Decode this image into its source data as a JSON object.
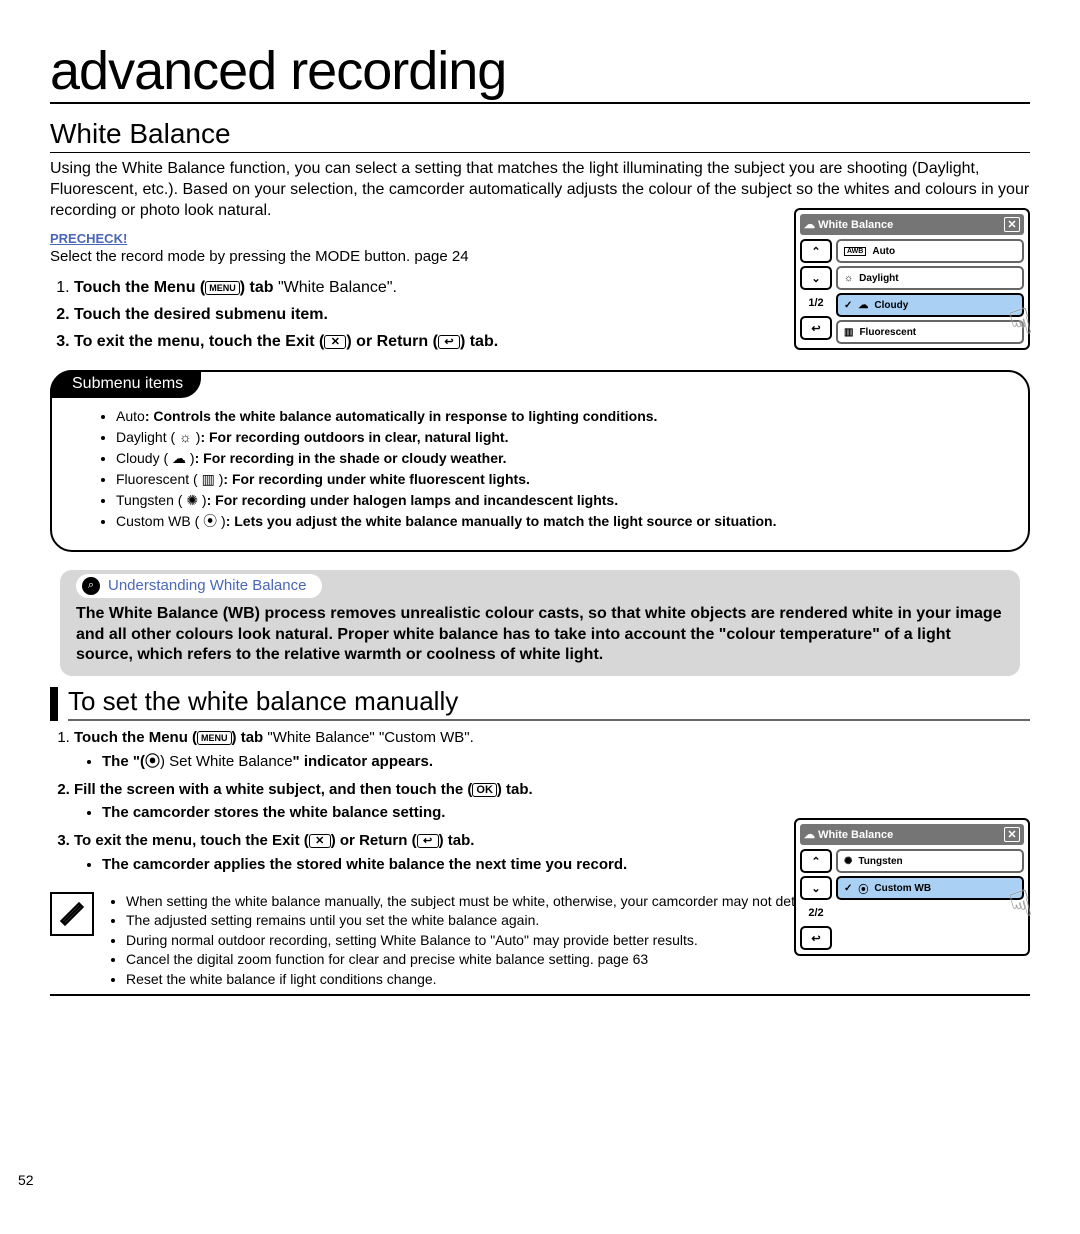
{
  "page_number": "52",
  "title": "advanced recording",
  "section_title": "White Balance",
  "intro": "Using the White Balance function, you can select a setting that matches the light illuminating the subject you are shooting (Daylight, Fluorescent, etc.). Based on your selection, the camcorder automatically adjusts the colour of the subject so the whites and colours in your recording or photo look natural.",
  "precheck_label": "PRECHECK!",
  "select_record": "Select the record mode by pressing the MODE button. page 24",
  "menu_chip": "MENU",
  "steps": {
    "s1a": "Touch the Menu (",
    "s1b": ") tab ",
    "s1c": " \"White Balance\".",
    "s2": "Touch the desired submenu item.",
    "s3a": "To exit the menu, touch the Exit (",
    "s3b": ") or Return (",
    "s3c": ") tab."
  },
  "exit_icon": "✕",
  "return_icon": "↩",
  "ok_icon": "OK",
  "submenu_label": "Submenu items",
  "submenu_items": [
    {
      "name": "Auto",
      "icon": "",
      "desc": ": Controls the white balance automatically in response to lighting conditions."
    },
    {
      "name": "Daylight",
      "icon": "☼",
      "desc": ": For recording outdoors in clear, natural light."
    },
    {
      "name": "Cloudy",
      "icon": "☁",
      "desc": ": For recording in the shade or cloudy weather."
    },
    {
      "name": "Fluorescent",
      "icon": "▥",
      "desc": ": For recording under white fluorescent lights."
    },
    {
      "name": "Tungsten",
      "icon": "✺",
      "desc": ": For recording under halogen lamps and incandescent lights."
    },
    {
      "name": "Custom WB",
      "icon": "⦿",
      "desc": ": Lets you adjust the white balance manually to match the light source or situation."
    }
  ],
  "understanding_title": "Understanding White Balance",
  "understanding_body": "The White Balance (WB) process removes unrealistic colour casts, so that white objects are rendered white in your image and all other colours look natural. Proper white balance has to take into account the \"colour temperature\" of a light source, which refers to the relative warmth or coolness of white light.",
  "manual_title": "To set the white balance manually",
  "manual": {
    "m1a": "Touch the Menu (",
    "m1b": ") tab ",
    "m1c": " \"White Balance\" ",
    "m1d": " \"Custom WB\".",
    "m1_sub_a": "The \"(",
    "m1_sub_b": ") Set White Balance\" indicator appears.",
    "m2": "Fill the screen with a white subject, and then touch the (",
    "m2b": ") tab.",
    "m2_sub": "The camcorder stores the white balance setting.",
    "m3a": "To exit the menu, touch the Exit (",
    "m3b": ") or Return (",
    "m3c": ") tab.",
    "m3_sub": "The camcorder applies the stored white balance the next time you record."
  },
  "notes": [
    "When setting the white balance manually, the subject must be white, otherwise, your camcorder may not detect an appropriate setting value.",
    "The adjusted setting remains until you set the white balance again.",
    "During normal outdoor recording, setting White Balance to \"Auto\" may provide better results.",
    "Cancel the digital zoom function for clear and precise white balance setting. page 63",
    "Reset the white balance if light conditions change."
  ],
  "device1": {
    "title": "White Balance",
    "counter": "1/2",
    "rows": [
      "Auto",
      "Daylight",
      "Cloudy",
      "Fluorescent"
    ],
    "icons": [
      "AWB",
      "☼",
      "☁",
      "▥"
    ],
    "selected": 2
  },
  "device2": {
    "title": "White Balance",
    "counter": "2/2",
    "rows": [
      "Tungsten",
      "Custom WB"
    ],
    "icons": [
      "✺",
      "⦿"
    ],
    "selected": 1
  }
}
